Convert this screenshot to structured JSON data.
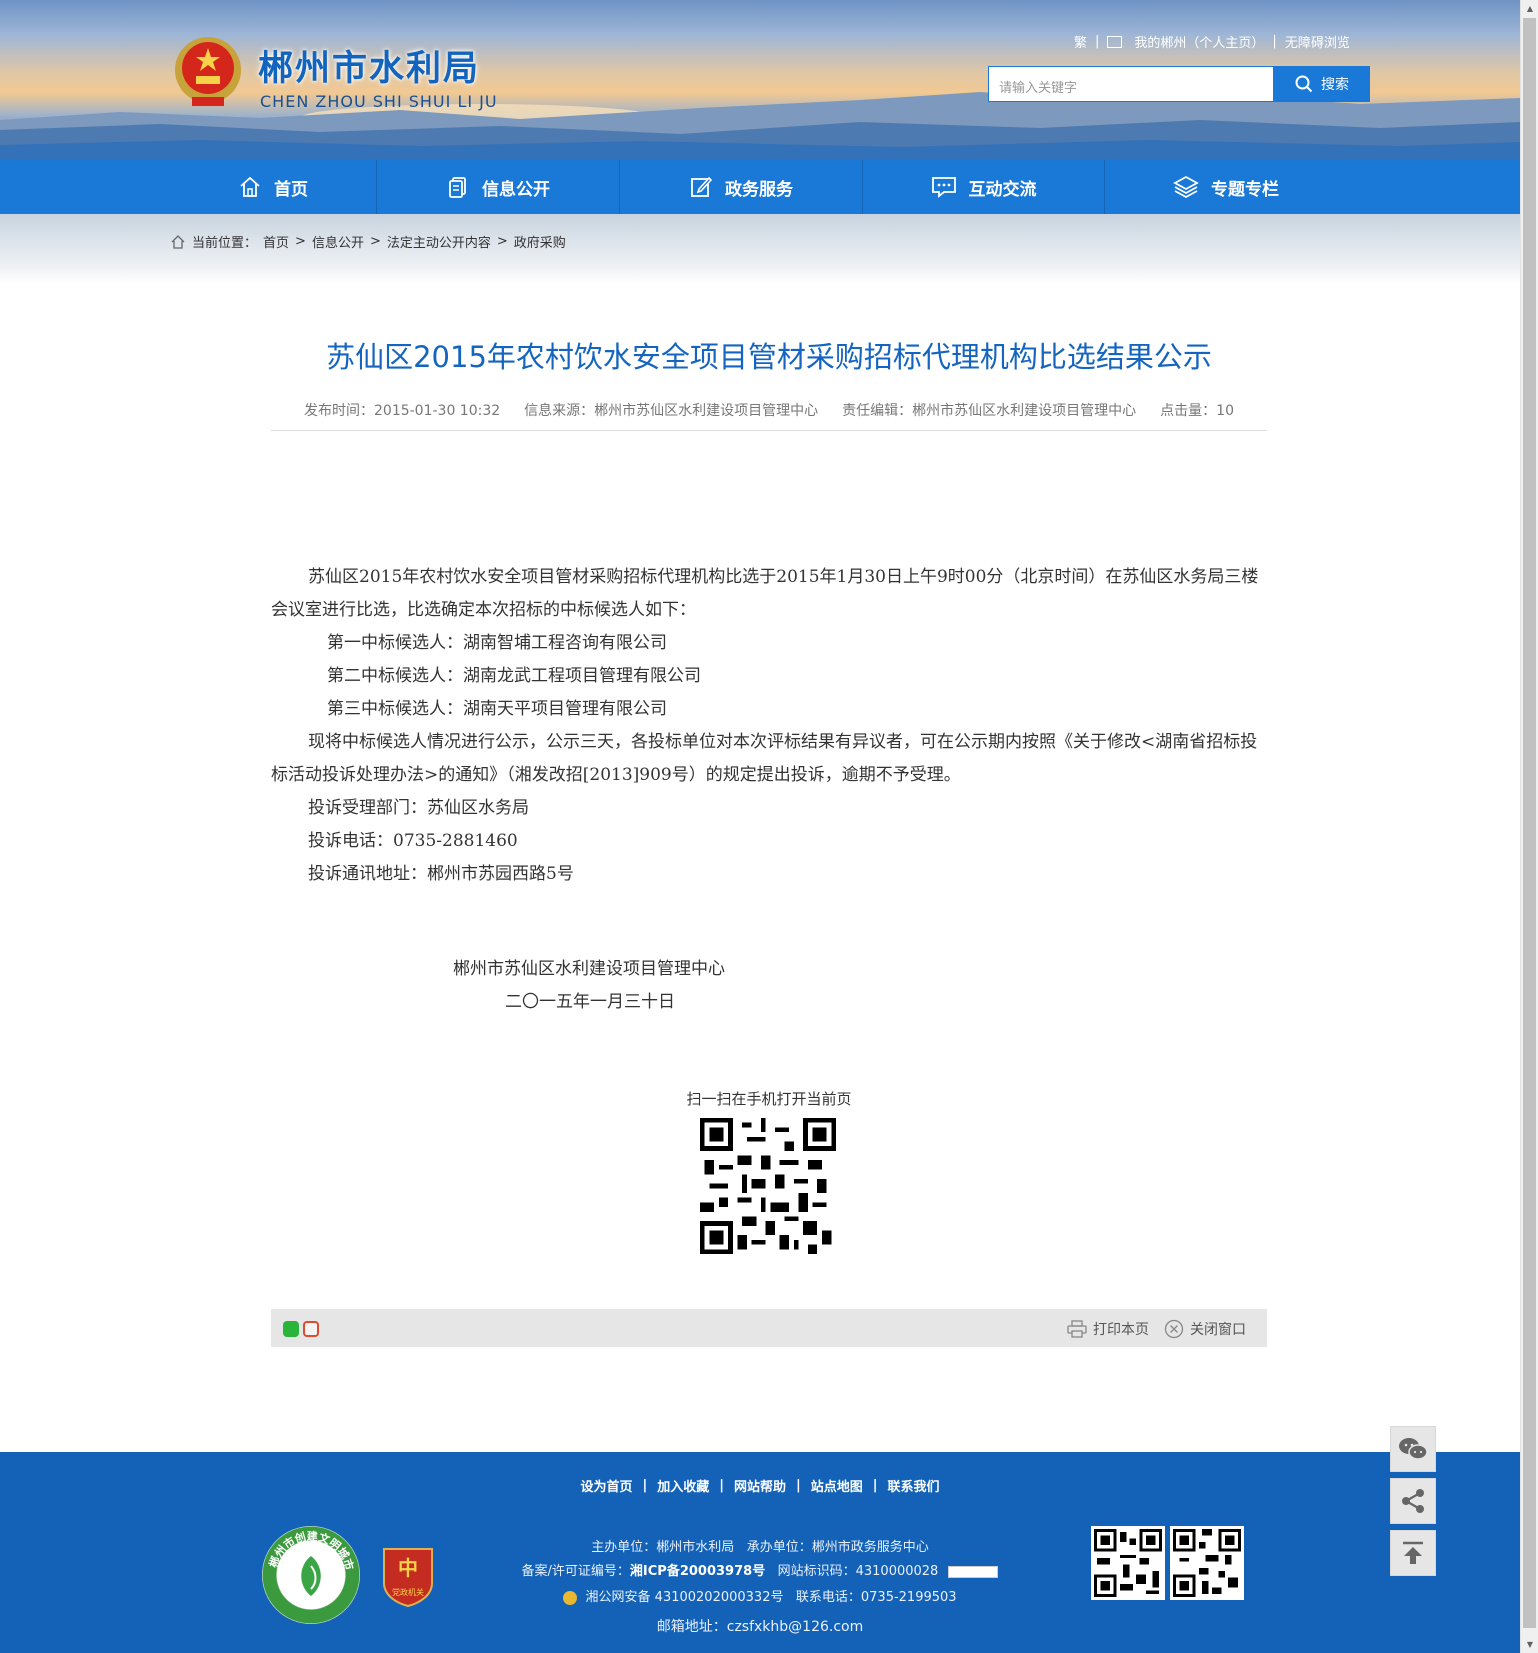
{
  "header": {
    "site_title": "郴州市水利局",
    "site_subtitle": "CHEN ZHOU SHI SHUI LI JU",
    "top_links": {
      "traditional": "繁",
      "my_chenzhou": "我的郴州（个人主页）",
      "accessibility": "无障碍浏览"
    },
    "search": {
      "placeholder": "请输入关键字",
      "button_label": "搜索"
    }
  },
  "nav": {
    "items": [
      {
        "label": "首页",
        "icon": "home-icon"
      },
      {
        "label": "信息公开",
        "icon": "document-icon"
      },
      {
        "label": "政务服务",
        "icon": "edit-icon"
      },
      {
        "label": "互动交流",
        "icon": "chat-icon"
      },
      {
        "label": "专题专栏",
        "icon": "layers-icon"
      }
    ]
  },
  "breadcrumb": {
    "prefix": "当前位置：",
    "items": [
      "首页",
      "信息公开",
      "法定主动公开内容",
      "政府采购"
    ],
    "separator": ">"
  },
  "article": {
    "title": "苏仙区2015年农村饮水安全项目管材采购招标代理机构比选结果公示",
    "meta": {
      "publish_time": "发布时间：2015-01-30 10:32",
      "source": "信息来源：郴州市苏仙区水利建设项目管理中心",
      "editor": "责任编辑：郴州市苏仙区水利建设项目管理中心",
      "views": "点击量：10"
    },
    "paragraphs": {
      "intro": "苏仙区2015年农村饮水安全项目管材采购招标代理机构比选于2015年1月30日上午9时00分（北京时间）在苏仙区水务局三楼会议室进行比选，比选确定本次招标的中标候选人如下：",
      "candidate1": "第一中标候选人：湖南智埔工程咨询有限公司",
      "candidate2": "第二中标候选人：湖南龙武工程项目管理有限公司",
      "candidate3": "第三中标候选人：湖南天平项目管理有限公司",
      "notice": "现将中标候选人情况进行公示，公示三天，各投标单位对本次评标结果有异议者，可在公示期内按照《关于修改<湖南省招标投标活动投诉处理办法>的通知》（湘发改招[2013]909号）的规定提出投诉，逾期不予受理。",
      "dept": "投诉受理部门：苏仙区水务局",
      "phone": "投诉电话：0735-2881460",
      "address": "投诉通讯地址：郴州市苏园西路5号"
    },
    "signature": {
      "org": "郴州市苏仙区水利建设项目管理中心",
      "date": "二〇一五年一月三十日"
    }
  },
  "qr": {
    "caption": "扫一扫在手机打开当前页"
  },
  "share_bar": {
    "print_label": "打印本页",
    "close_label": "关闭窗口"
  },
  "footer": {
    "links": [
      "设为首页",
      "加入收藏",
      "网站帮助",
      "站点地图",
      "联系我们"
    ],
    "sponsor": "主办单位：郴州市水利局",
    "undertaker": "承办单位：郴州市政务服务中心",
    "icp_label": "备案/许可证编号：",
    "icp_value": "湘ICP备20003978号",
    "site_id": "网站标识码：4310000028",
    "police": "湘公网安备 43100202000332号",
    "contact_phone": "联系电话：0735-2199503",
    "email": "邮箱地址：czsfxkhb@126.com",
    "badge_green_text": "郴州市创建文明城市",
    "badge_red_text": "党政机关"
  },
  "colors": {
    "primary_blue": "#1a78d6",
    "title_blue": "#1565c0",
    "footer_blue": "#1462b8"
  }
}
